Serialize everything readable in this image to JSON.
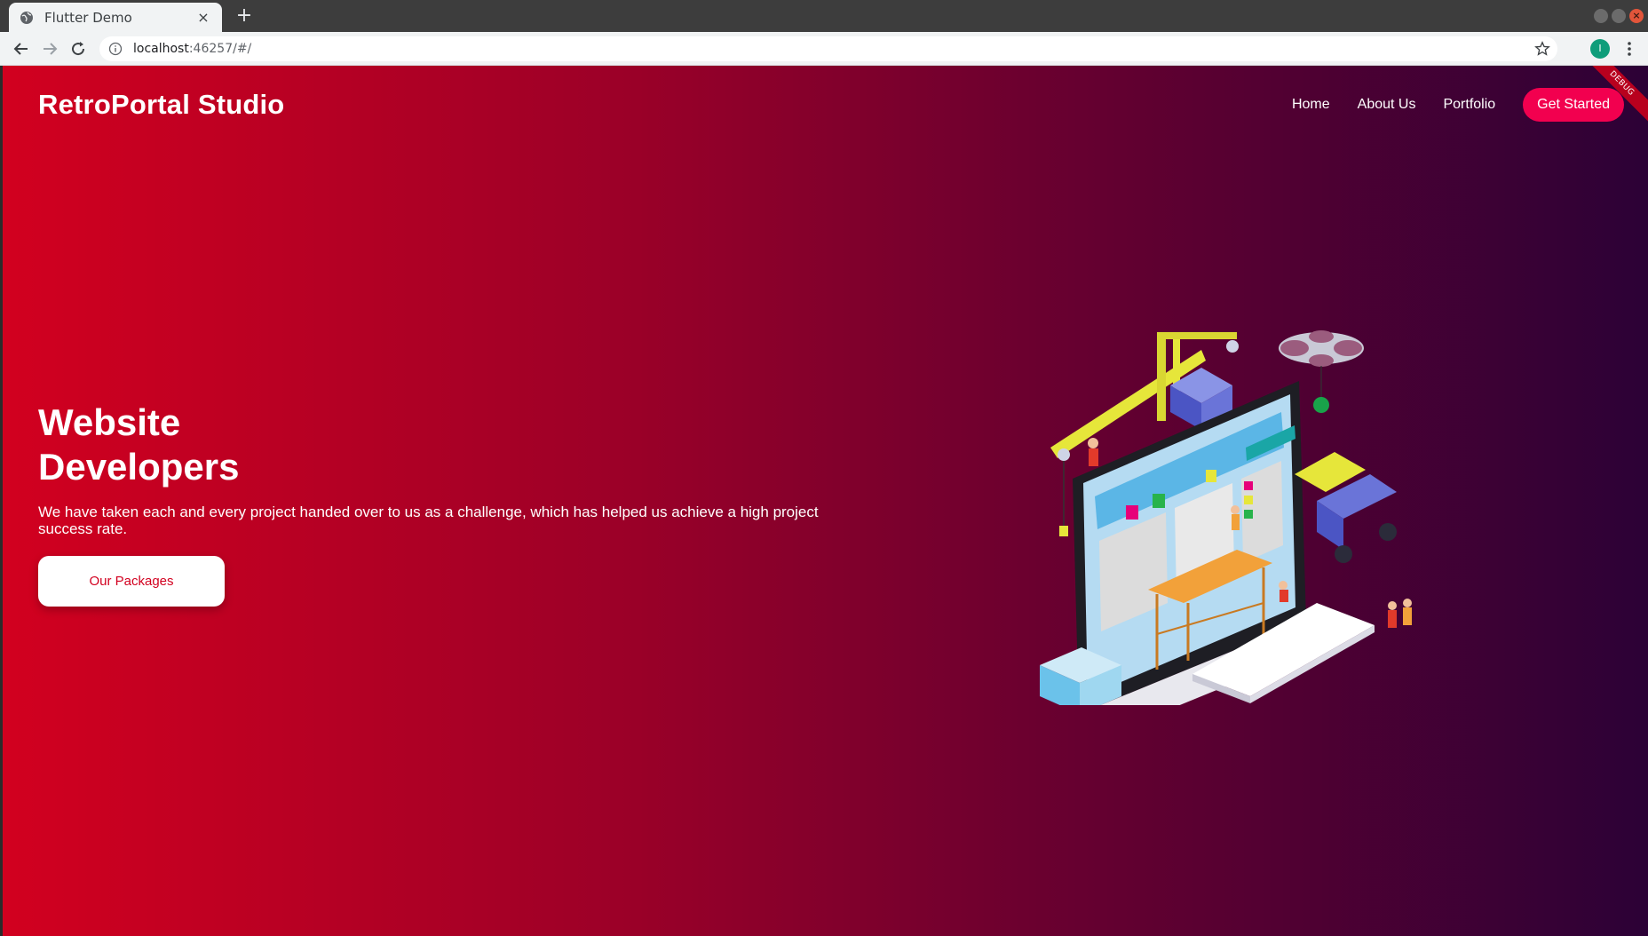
{
  "browser": {
    "tab_title": "Flutter Demo",
    "tab_close": "×",
    "new_tab": "+",
    "url_host": "localhost",
    "url_rest": ":46257/#/",
    "profile_initial": "I"
  },
  "page": {
    "brand": "RetroPortal Studio",
    "nav": {
      "items": [
        {
          "label": "Home"
        },
        {
          "label": "About Us"
        },
        {
          "label": "Portfolio"
        }
      ],
      "cta": "Get Started"
    },
    "debug_banner": "DEBUG",
    "hero": {
      "title_line1": "Website",
      "title_line2": "Developers",
      "description": "We have taken each and every project handed over to us as a challenge, which has helped us achieve a high project success rate.",
      "button": "Our Packages"
    },
    "illustration_icon": "isometric-web-development-icon"
  },
  "colors": {
    "gradient_start": "#d2001f",
    "gradient_end": "#2c0136",
    "cta_background": "#f2004f",
    "button_text": "#d2001f"
  }
}
